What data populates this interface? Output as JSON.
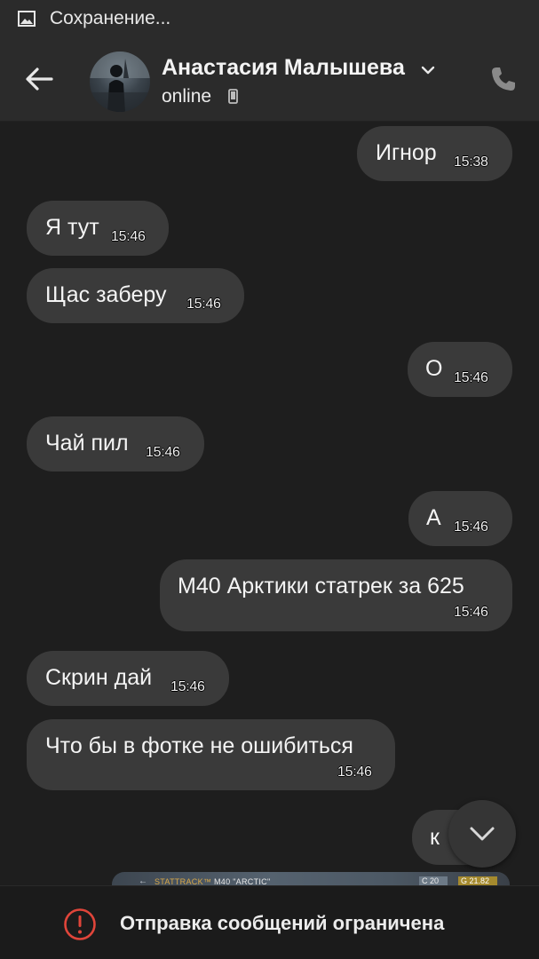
{
  "status_bar": {
    "text": "Сохранение...",
    "icon": "image-icon"
  },
  "header": {
    "contact_name": "Анастасия Малышева",
    "contact_status": "online",
    "back_icon": "arrow-left-icon",
    "call_icon": "phone-icon",
    "chevron_icon": "chevron-down-icon",
    "device_icon": "mobile-device-icon"
  },
  "messages": [
    {
      "direction": "outgoing",
      "text": "Игнор",
      "time": "15:38"
    },
    {
      "direction": "incoming",
      "text": "Я тут",
      "time": "15:46"
    },
    {
      "direction": "incoming",
      "text": "Щас заберу",
      "time": "15:46"
    },
    {
      "direction": "outgoing",
      "text": "О",
      "time": "15:46"
    },
    {
      "direction": "incoming",
      "text": "Чай пил",
      "time": "15:46"
    },
    {
      "direction": "outgoing",
      "text": "А",
      "time": "15:46"
    },
    {
      "direction": "outgoing",
      "text": "М40 Арктики статрек за 625",
      "time": "15:46"
    },
    {
      "direction": "incoming",
      "text": "Скрин дай",
      "time": "15:46"
    },
    {
      "direction": "incoming",
      "text": "Что бы в фотке не ошибиться",
      "time": "15:46"
    },
    {
      "direction": "outgoing",
      "text": "к",
      "time": ""
    }
  ],
  "image_preview": {
    "label_prefix": "STATTRACK™",
    "label_item": "M40 \"ARCTIC\"",
    "chip_c": "C 20",
    "chip_g": "G 21.82"
  },
  "scroll_down_icon": "chevron-down-icon",
  "bottom_bar": {
    "text": "Отправка сообщений ограничена",
    "icon": "exclamation-circle-icon"
  },
  "colors": {
    "background": "#1e1e1e",
    "header": "#2b2b2b",
    "bubble": "#3a3a3a",
    "warning": "#e0453a"
  }
}
